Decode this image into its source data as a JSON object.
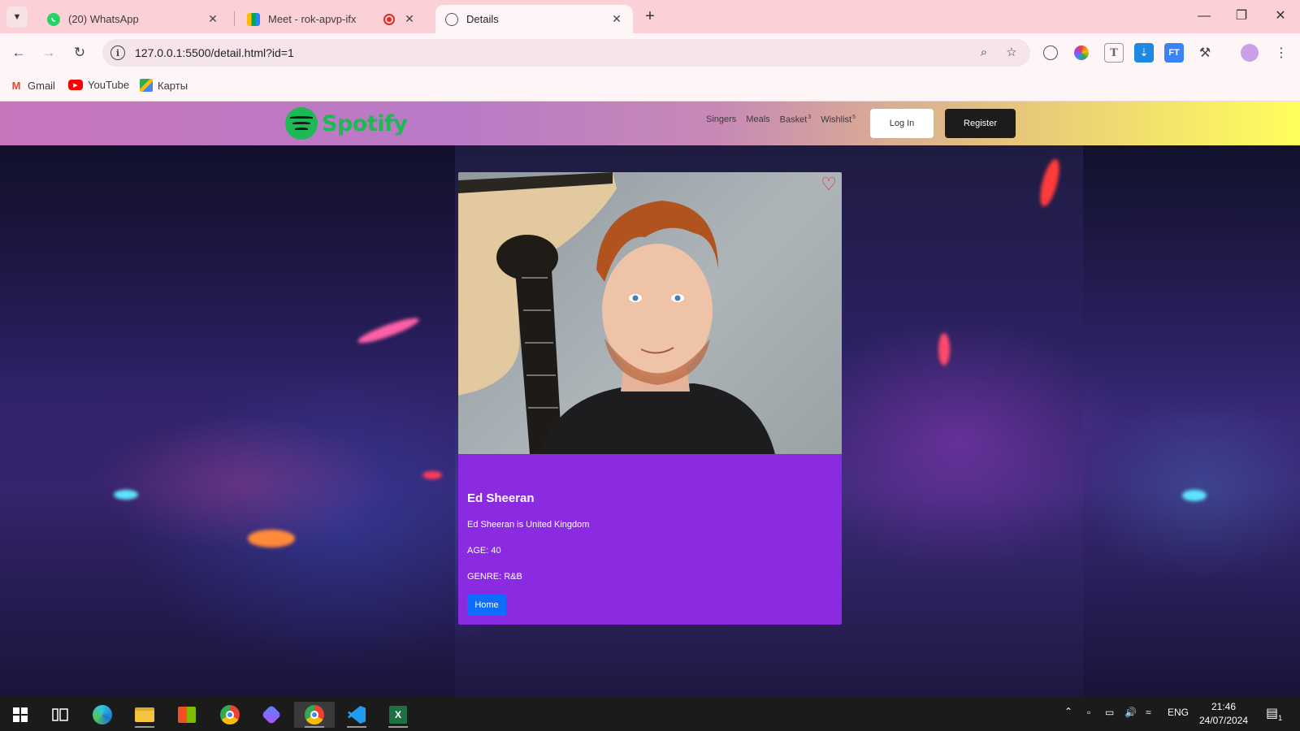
{
  "browser": {
    "tabs": [
      {
        "title": "(20) WhatsApp",
        "icon": "whatsapp-icon"
      },
      {
        "title": "Meet - rok-apvp-ifx",
        "icon": "google-meet-icon"
      },
      {
        "title": "Details",
        "icon": "globe-icon",
        "active": true
      }
    ],
    "url": "127.0.0.1:5500/detail.html?id=1",
    "bookmarks": [
      {
        "label": "Gmail",
        "icon": "gmail-icon"
      },
      {
        "label": "YouTube",
        "icon": "youtube-icon"
      },
      {
        "label": "Карты",
        "icon": "maps-icon"
      }
    ]
  },
  "site": {
    "logo_text": "Spotify",
    "nav": [
      {
        "label": "Singers"
      },
      {
        "label": "Meals"
      },
      {
        "label": "Basket",
        "count": "3"
      },
      {
        "label": "Wishlist",
        "count": "5"
      }
    ],
    "login_label": "Log In",
    "register_label": "Register"
  },
  "card": {
    "name": "Ed Sheeran",
    "description": "Ed Sheeran is United Kingdom",
    "age_line": "AGE: 40",
    "genre_line": "GENRE: R&B",
    "home_label": "Home",
    "accent_color": "#8a2be2",
    "button_color": "#0d6efd"
  },
  "taskbar": {
    "language": "ENG",
    "time": "21:46",
    "date": "24/07/2024",
    "notification_count": "1"
  }
}
